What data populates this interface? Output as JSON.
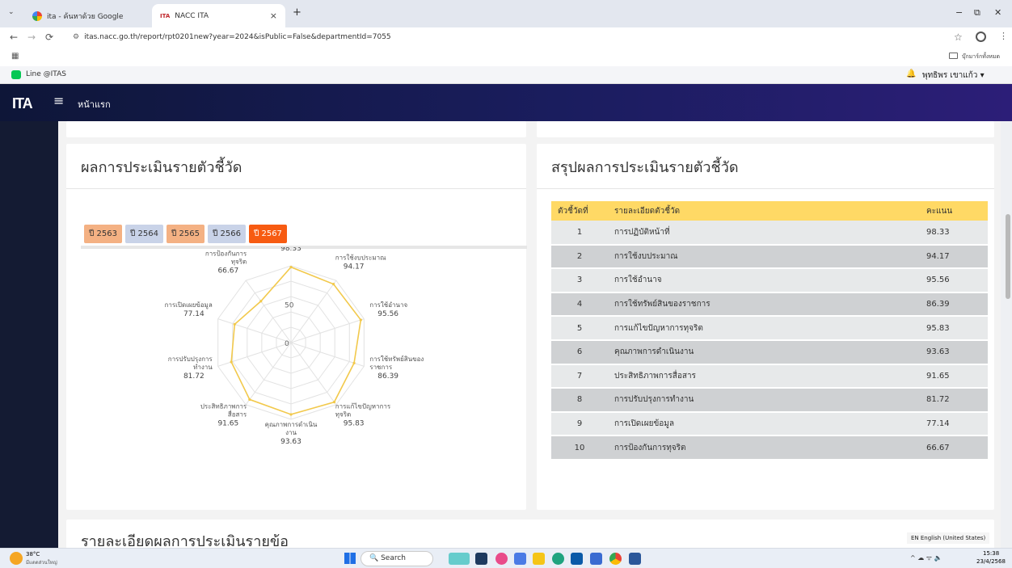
{
  "browser": {
    "tab1": "ita - ค้นหาด้วย Google",
    "tab2": "NACC ITA",
    "url": "itas.nacc.go.th/report/rpt0201new?year=2024&isPublic=False&departmentId=7055",
    "bookmarks_folder": "บุ๊กมาร์กทั้งหมด",
    "ext_label": "Line @ITAS",
    "user": "พุทธิพร เขาแก้ว ▾",
    "new_tab": "+",
    "close": "×",
    "min": "−",
    "restore": "⧉",
    "winclose": "✕",
    "star": "☆"
  },
  "header": {
    "logo": "ITA",
    "home": "หน้าแรก",
    "menu_icon": "hamburger-icon"
  },
  "left_card": {
    "title": "ผลการประเมินรายตัวชี้วัด",
    "years": [
      "ปี 2563",
      "ปี 2564",
      "ปี 2565",
      "ปี 2566",
      "ปี 2567"
    ]
  },
  "chart_data": {
    "type": "radar",
    "scale_labels": [
      "0",
      "50"
    ],
    "rmax": 100,
    "categories": [
      [
        "การปฏิบัติหน้าที่"
      ],
      [
        "การใช้งบประมาณ"
      ],
      [
        "การใช้อำนาจ"
      ],
      [
        "การใช้ทรัพย์สินของ",
        "ราชการ"
      ],
      [
        "การแก้ไขปัญหาการ",
        "ทุจริต"
      ],
      [
        "คุณภาพการดำเนิน",
        "งาน"
      ],
      [
        "ประสิทธิภาพการ",
        "สื่อสาร"
      ],
      [
        "การปรับปรุงการ",
        "ทำงาน"
      ],
      [
        "การเปิดเผยข้อมูล"
      ],
      [
        "การป้องกันการ",
        "ทุจริต"
      ]
    ],
    "values": [
      98.33,
      94.17,
      95.56,
      86.39,
      95.83,
      93.63,
      91.65,
      81.72,
      77.14,
      66.67
    ],
    "value_labels": [
      "98.33",
      "94.17",
      "95.56",
      "86.39",
      "95.83",
      "93.63",
      "91.65",
      "81.72",
      "77.14",
      "66.67"
    ],
    "line_color": "#f2c94c"
  },
  "right_card": {
    "title": "สรุปผลการประเมินรายตัวชี้วัด",
    "headers": [
      "ตัวชี้วัดที่",
      "รายละเอียดตัวชี้วัด",
      "คะแนน"
    ],
    "rows": [
      [
        "1",
        "การปฏิบัติหน้าที่",
        "98.33"
      ],
      [
        "2",
        "การใช้งบประมาณ",
        "94.17"
      ],
      [
        "3",
        "การใช้อำนาจ",
        "95.56"
      ],
      [
        "4",
        "การใช้ทรัพย์สินของราชการ",
        "86.39"
      ],
      [
        "5",
        "การแก้ไขปัญหาการทุจริต",
        "95.83"
      ],
      [
        "6",
        "คุณภาพการดำเนินงาน",
        "93.63"
      ],
      [
        "7",
        "ประสิทธิภาพการสื่อสาร",
        "91.65"
      ],
      [
        "8",
        "การปรับปรุงการทำงาน",
        "81.72"
      ],
      [
        "9",
        "การเปิดเผยข้อมูล",
        "77.14"
      ],
      [
        "10",
        "การป้องกันการทุจริต",
        "66.67"
      ]
    ]
  },
  "bottom_title": "รายละเอียดผลการประเมินรายข้อ",
  "lang_tooltip": "EN English (United States)",
  "taskbar": {
    "weather_temp": "38°C",
    "weather_text": "มีแดดส่วนใหญ่",
    "search": "Search",
    "time": "15:38",
    "date": "23/4/2568",
    "tray": "^ ☁ ᯤ 🔈"
  }
}
